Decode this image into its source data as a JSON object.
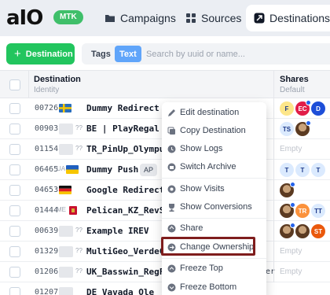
{
  "header": {
    "logo": "aIO",
    "badge": "MTK",
    "tabs": [
      {
        "label": "Campaigns",
        "icon": "folder-icon"
      },
      {
        "label": "Sources",
        "icon": "grid-icon"
      },
      {
        "label": "Destinations",
        "icon": "destination-icon",
        "active": true
      }
    ]
  },
  "toolbar": {
    "add_label": "Destination",
    "seg_tags": "Tags",
    "seg_text": "Text",
    "search_placeholder": "Search by uuid or name..."
  },
  "table": {
    "col_destination": "Destination",
    "col_destination_sub": "Identity",
    "col_shares": "Shares",
    "col_shares_sub": "Default",
    "rows": [
      {
        "id": "00726",
        "cc": "",
        "flag": "se",
        "name": "Dummy Redirect",
        "shares": [
          "F",
          "EC",
          "D"
        ]
      },
      {
        "id": "00903",
        "cc": "??",
        "flag": "",
        "name": "BE | PlayRegal |",
        "shares": [
          "TS"
        ]
      },
      {
        "id": "01154",
        "cc": "??",
        "flag": "",
        "name": "TR_PinUp_Olympus",
        "empty": "Empty"
      },
      {
        "id": "06465",
        "cc": "UA",
        "flag": "ua",
        "name": "Dummy Push",
        "chip": "AP",
        "shares": [
          "T",
          "T",
          "T"
        ]
      },
      {
        "id": "04653",
        "cc": "",
        "flag": "de",
        "name": "Google Redirect",
        "shares": [
          "photo"
        ]
      },
      {
        "id": "01444",
        "cc": "ME",
        "flag": "me",
        "name": "Pelican_KZ_RevSha",
        "shares": [
          "photo",
          "TR",
          "TT"
        ]
      },
      {
        "id": "00639",
        "cc": "??",
        "flag": "",
        "name": "Example IREV",
        "shares": [
          "photo",
          "photo",
          "ST"
        ]
      },
      {
        "id": "01329",
        "cc": "??",
        "flag": "",
        "name": "MultiGeo_VerdeCas",
        "empty": "Empty"
      },
      {
        "id": "01206",
        "cc": "??",
        "flag": "",
        "name": "UK_Basswin_RegFor",
        "tail": "er",
        "empty": "Empty"
      },
      {
        "id": "01207",
        "cc": "??",
        "flag": "",
        "name": "DE_Vavada_Ole",
        "empty": ""
      }
    ]
  },
  "context_menu": {
    "items": [
      {
        "label": "Edit destination",
        "icon": "pencil-icon"
      },
      {
        "label": "Copy Destination",
        "icon": "copy-icon"
      },
      {
        "label": "Show Logs",
        "icon": "logs-icon"
      },
      {
        "label": "Switch Archive",
        "icon": "archive-icon"
      },
      {
        "label": "Show Visits",
        "icon": "visits-icon"
      },
      {
        "label": "Show Conversions",
        "icon": "trophy-icon"
      },
      {
        "label": "Share",
        "icon": "share-icon"
      },
      {
        "label": "Change Ownership",
        "icon": "ownership-icon",
        "highlighted": true
      },
      {
        "label": "Freeze Top",
        "icon": "freeze-top-icon"
      },
      {
        "label": "Freeze Bottom",
        "icon": "freeze-bottom-icon"
      }
    ]
  },
  "colors": {
    "accent_green": "#22c55e",
    "accent_blue": "#60a5fa",
    "highlight_border": "#7f1d1d"
  }
}
